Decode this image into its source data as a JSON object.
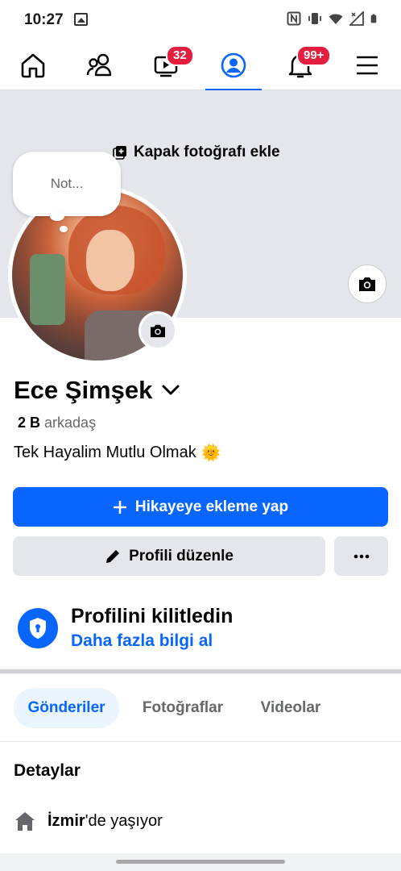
{
  "status_bar": {
    "time": "10:27"
  },
  "nav": {
    "video_badge": "32",
    "notifications_badge": "99+"
  },
  "cover": {
    "add_cover_label": "Kapak fotoğrafı ekle"
  },
  "note": {
    "placeholder": "Not..."
  },
  "profile": {
    "name": "Ece Şimşek",
    "friends_count": "2 B",
    "friends_label": "arkadaş",
    "bio": "Tek Hayalim Mutlu Olmak",
    "bio_emoji": "🌞"
  },
  "buttons": {
    "add_story": "Hikayeye ekleme yap",
    "edit_profile": "Profili düzenle",
    "more": "···"
  },
  "lock": {
    "title": "Profilini kilitledin",
    "link": "Daha fazla bilgi al"
  },
  "tabs": [
    {
      "label": "Gönderiler"
    },
    {
      "label": "Fotoğraflar"
    },
    {
      "label": "Videolar"
    }
  ],
  "details": {
    "title": "Detaylar",
    "city": "İzmir",
    "city_suffix": "'de yaşıyor"
  },
  "colors": {
    "accent": "#0866ff",
    "badge": "#e41e3f",
    "cover_bg": "#e4e6eb",
    "secondary_btn": "#e4e6eb"
  }
}
